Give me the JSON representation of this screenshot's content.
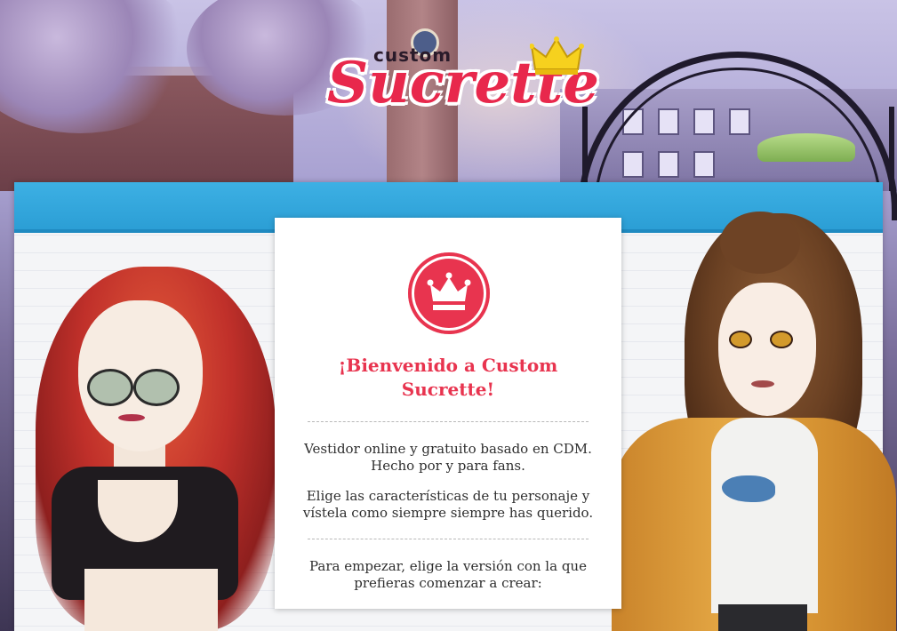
{
  "logo": {
    "small_text": "custom",
    "main_text": "Sucrette"
  },
  "welcome": {
    "title": "¡Bienvenido a Custom Sucrette!",
    "intro_line1": "Vestidor online y gratuito basado en CDM.",
    "intro_line2": "Hecho por y para fans.",
    "features": "Elige las características de tu personaje y vístela como siempre siempre has querido.",
    "start_prompt": "Para empezar, elige la versión con la que prefieras comenzar a crear:"
  },
  "colors": {
    "accent": "#e8344f",
    "header_bar": "#2a9dd4",
    "card_bg": "#ffffff",
    "body_text": "#2f2f2f"
  },
  "icons": {
    "badge": "crown-icon",
    "logo_crown": "crown-icon"
  }
}
